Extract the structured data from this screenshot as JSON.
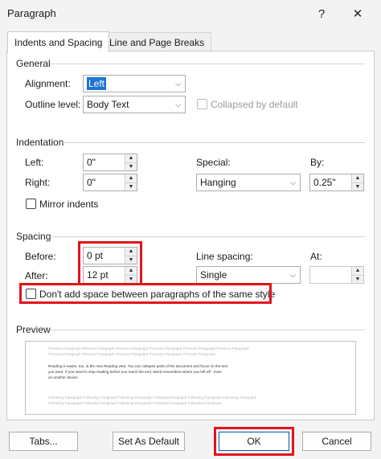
{
  "window": {
    "title": "Paragraph",
    "help_label": "?",
    "close_label": "✕"
  },
  "tabs": [
    {
      "label": "Indents and Spacing",
      "active": true
    },
    {
      "label": "Line and Page Breaks",
      "active": false
    }
  ],
  "general": {
    "heading": "General",
    "alignment_label": "Alignment:",
    "alignment_value": "Left",
    "outline_label": "Outline level:",
    "outline_value": "Body Text",
    "collapsed_label": "Collapsed by default"
  },
  "indentation": {
    "heading": "Indentation",
    "left_label": "Left:",
    "left_value": "0\"",
    "right_label": "Right:",
    "right_value": "0\"",
    "special_label": "Special:",
    "special_value": "Hanging",
    "by_label": "By:",
    "by_value": "0.25\"",
    "mirror_label": "Mirror indents"
  },
  "spacing": {
    "heading": "Spacing",
    "before_label": "Before:",
    "before_value": "0 pt",
    "after_label": "After:",
    "after_value": "12 pt",
    "line_spacing_label": "Line spacing:",
    "line_spacing_value": "Single",
    "at_label": "At:",
    "at_value": "",
    "dont_add_label": "Don't add space between paragraphs of the same style"
  },
  "preview": {
    "heading": "Preview",
    "prev_line1": "Previous Paragraph Previous Paragraph Previous Paragraph Previous Paragraph Previous Paragraph Previous Paragraph",
    "prev_line2": "Previous Paragraph Previous Paragraph Previous Paragraph Previous Paragraph Previous Paragraph",
    "main_line1": "Reading is easier, too, in the new Reading view. You can collapse parts of the document and focus on the text",
    "main_line2": "you want. If you need to stop reading before you reach the end, Word remembers where you left off - even",
    "main_line3": "on another device.",
    "follow_line1": "Following Paragraph Following Paragraph Following Paragraph Following Paragraph Following Paragraph Following Paragraph",
    "follow_line2": "Following Paragraph Following Paragraph Following Paragraph Following Paragraph Following Paragraph"
  },
  "buttons": {
    "tabs_label": "Tabs...",
    "default_label": "Set As Default",
    "ok_label": "OK",
    "cancel_label": "Cancel"
  },
  "colors": {
    "highlight": "#e3131b",
    "selection": "#1e73d6"
  },
  "icons": {
    "combo_arrow": "chevron-down-icon",
    "spin_up": "caret-up-icon",
    "spin_down": "caret-down-icon"
  }
}
